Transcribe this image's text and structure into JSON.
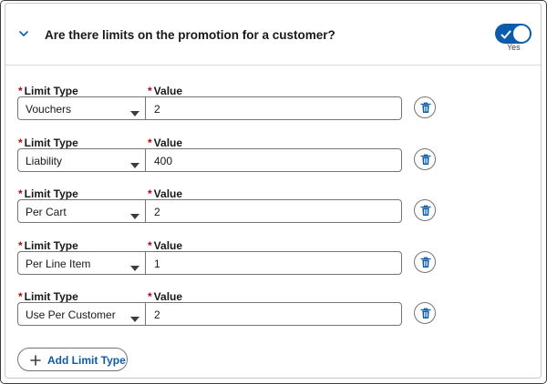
{
  "section": {
    "question": "Are there limits on the promotion for a customer?",
    "toggle_state": "Yes",
    "toggle_on": true,
    "accent": "#0b5cab"
  },
  "fields": {
    "type_label": "Limit Type",
    "value_label": "Value",
    "required_marker": "*"
  },
  "limits": [
    {
      "type": "Vouchers",
      "value": "2"
    },
    {
      "type": "Liability",
      "value": "400"
    },
    {
      "type": "Per Cart",
      "value": "2"
    },
    {
      "type": "Per Line Item",
      "value": "1"
    },
    {
      "type": "Use Per Customer",
      "value": "2"
    }
  ],
  "add_button": {
    "label": "Add Limit Type",
    "icon": "plus-icon"
  },
  "delete_icon": "trash-icon"
}
